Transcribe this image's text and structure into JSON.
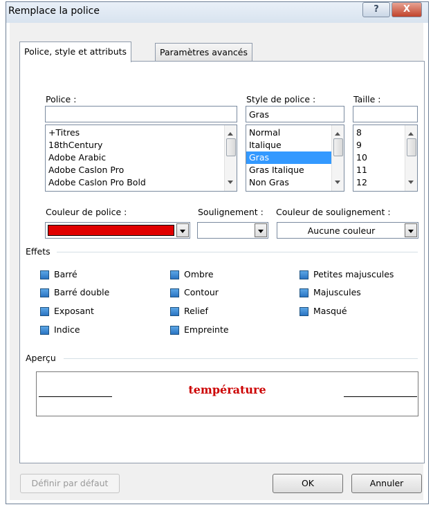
{
  "window": {
    "title": "Remplace la police",
    "help_glyph": "?",
    "close_glyph": "X"
  },
  "tabs": [
    {
      "label": "Police, style et attributs"
    },
    {
      "label": "Paramètres avancés"
    }
  ],
  "font": {
    "label": "Police :",
    "value": "",
    "items": [
      "+Titres",
      "18thCentury",
      "Adobe Arabic",
      "Adobe Caslon Pro",
      "Adobe Caslon Pro Bold"
    ]
  },
  "style": {
    "label": "Style de police :",
    "value": "Gras",
    "items": [
      "Normal",
      "Italique",
      "Gras",
      "Gras Italique",
      "Non Gras"
    ],
    "selected": "Gras"
  },
  "size": {
    "label": "Taille :",
    "value": "",
    "items": [
      "8",
      "9",
      "10",
      "11",
      "12"
    ]
  },
  "font_color": {
    "label": "Couleur de police :",
    "value_color": "#e00000"
  },
  "underline": {
    "label": "Soulignement :",
    "value": ""
  },
  "underline_color": {
    "label": "Couleur de soulignement :",
    "value": "Aucune couleur"
  },
  "effects": {
    "label": "Effets",
    "col1": [
      "Barré",
      "Barré double",
      "Exposant",
      "Indice"
    ],
    "col2": [
      "Ombre",
      "Contour",
      "Relief",
      "Empreinte"
    ],
    "col3": [
      "Petites majuscules",
      "Majuscules",
      "Masqué"
    ]
  },
  "preview": {
    "label": "Aperçu",
    "text": "température",
    "text_color": "#cc0000"
  },
  "buttons": {
    "default": "Définir par défaut",
    "ok": "OK",
    "cancel": "Annuler"
  }
}
